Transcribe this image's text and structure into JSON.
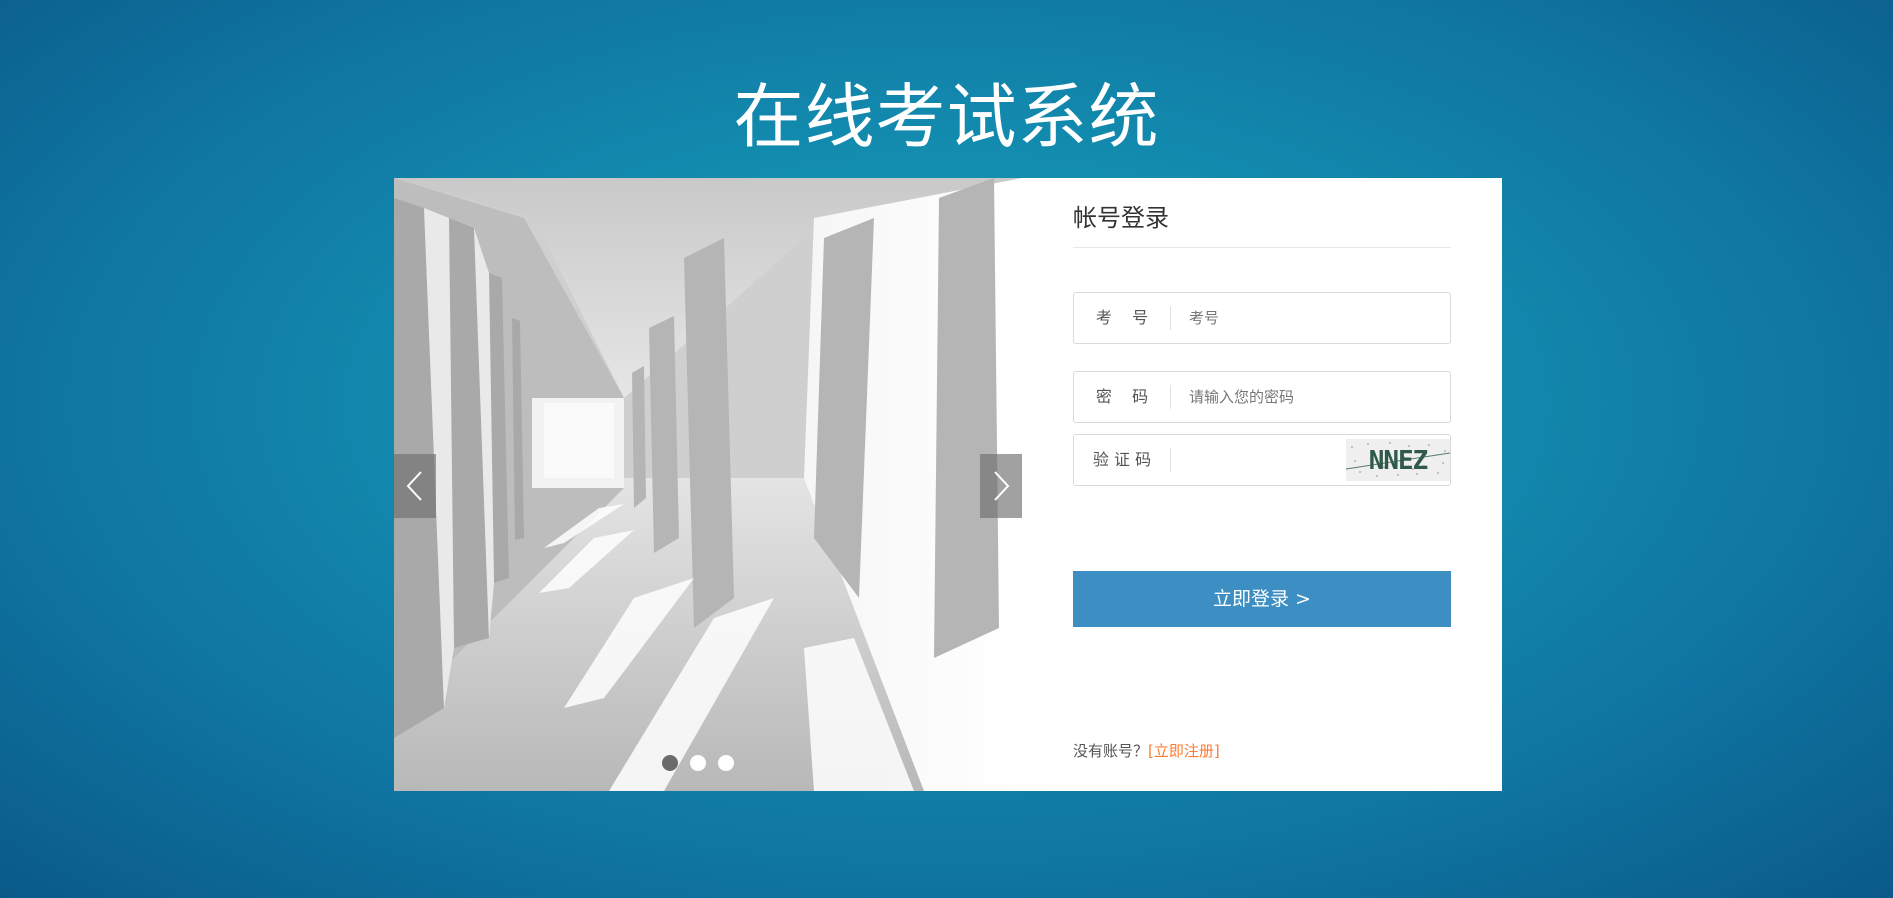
{
  "page": {
    "title": "在线考试系统"
  },
  "carousel": {
    "slide_count": 3,
    "active_slide": 1,
    "prev_icon": "chevron-left-icon",
    "next_icon": "chevron-right-icon"
  },
  "login": {
    "heading": "帐号登录",
    "fields": [
      {
        "label": "考    号",
        "placeholder": "考号",
        "value": ""
      },
      {
        "label": "密    码",
        "placeholder": "请输入您的密码",
        "value": ""
      },
      {
        "label": "验 证 码",
        "placeholder": "",
        "value": ""
      }
    ],
    "captcha_text": "NNEZ",
    "submit_label": "立即登录 >",
    "register_prompt": "没有账号？",
    "register_link": "[立即注册]"
  },
  "colors": {
    "background": "#138db0",
    "button": "#3d8ec2",
    "link": "#ff7a2f"
  }
}
